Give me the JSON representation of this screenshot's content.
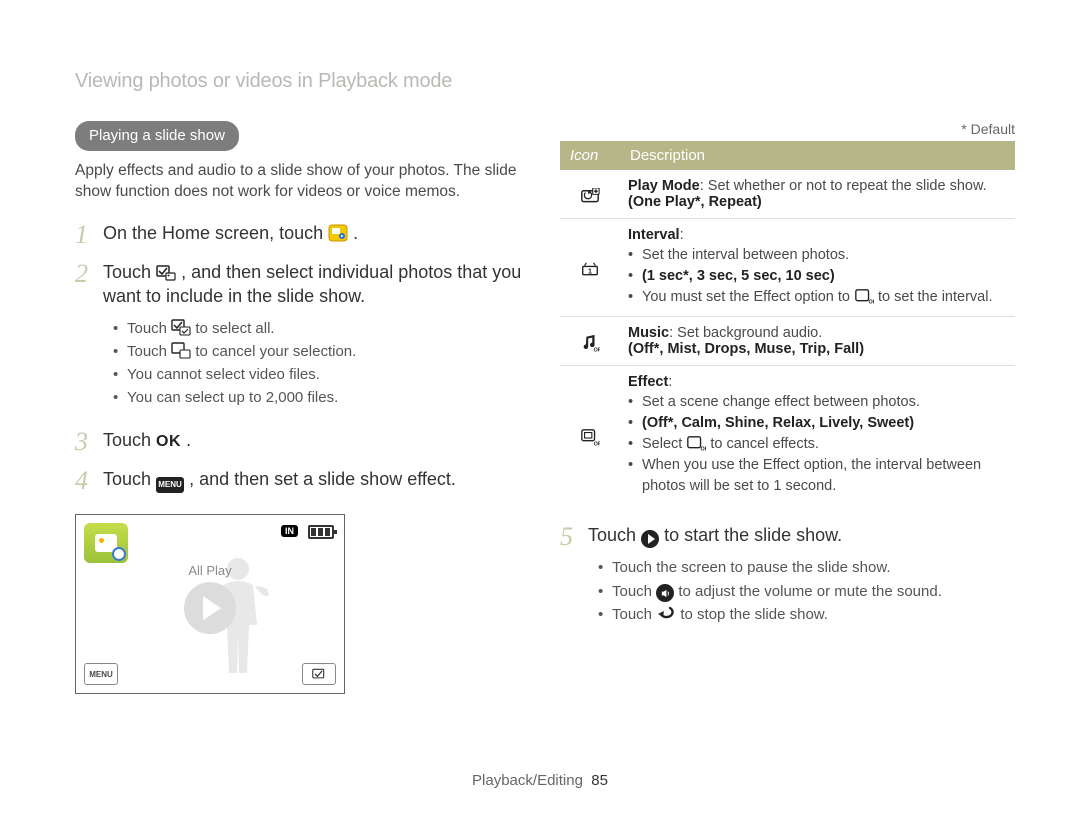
{
  "breadcrumb": "Viewing photos or videos in Playback mode",
  "section_pill": "Playing a slide show",
  "intro": "Apply effects and audio to a slide show of your photos. The slide show function does not work for videos or voice memos.",
  "steps": {
    "s1": {
      "num": "1",
      "pre": "On the Home screen, touch ",
      "post": "."
    },
    "s2": {
      "num": "2",
      "pre": "Touch ",
      "mid": ", and then select individual photos that you want to include in the slide show.",
      "bullets": [
        {
          "pre": "Touch ",
          "post": " to select all."
        },
        {
          "pre": "Touch ",
          "post": " to cancel your selection."
        },
        {
          "text": "You cannot select video files."
        },
        {
          "text": "You can select up to 2,000 files."
        }
      ]
    },
    "s3": {
      "num": "3",
      "pre": "Touch ",
      "ok": "OK",
      "post": "."
    },
    "s4": {
      "num": "4",
      "pre": "Touch ",
      "menu": "MENU",
      "post": ", and then set a slide show effect."
    },
    "s5": {
      "num": "5",
      "pre": "Touch ",
      "post": " to start the slide show.",
      "bullets": [
        {
          "text": "Touch the screen to pause the slide show."
        },
        {
          "pre": "Touch ",
          "post": " to adjust the volume or mute the sound."
        },
        {
          "pre": "Touch ",
          "post": " to stop the slide show."
        }
      ]
    }
  },
  "mock": {
    "all_play": "All Play",
    "in_badge": "IN",
    "menu": "MENU"
  },
  "default_note": "* Default",
  "table": {
    "head_icon": "Icon",
    "head_desc": "Description",
    "rows": {
      "playmode": {
        "title": "Play Mode",
        "desc": ": Set whether or not to repeat the slide show.",
        "options": "(One Play*, Repeat)"
      },
      "interval": {
        "title": "Interval",
        "bullets": [
          "Set the interval between photos.",
          "(1 sec*, 3 sec, 5 sec, 10 sec)",
          {
            "pre": "You must set the Effect option to ",
            "post": " to set the interval."
          }
        ]
      },
      "music": {
        "title": "Music",
        "desc": ": Set background audio.",
        "options": "(Off*, Mist, Drops, Muse, Trip, Fall)"
      },
      "effect": {
        "title": "Effect",
        "bullets": [
          "Set a scene change effect between photos.",
          "(Off*, Calm, Shine, Relax, Lively, Sweet)",
          {
            "pre": "Select ",
            "post": " to cancel effects."
          },
          "When you use the Effect option, the interval between photos will be set to 1 second."
        ]
      }
    }
  },
  "footer": {
    "section": "Playback/Editing",
    "page": "85"
  }
}
